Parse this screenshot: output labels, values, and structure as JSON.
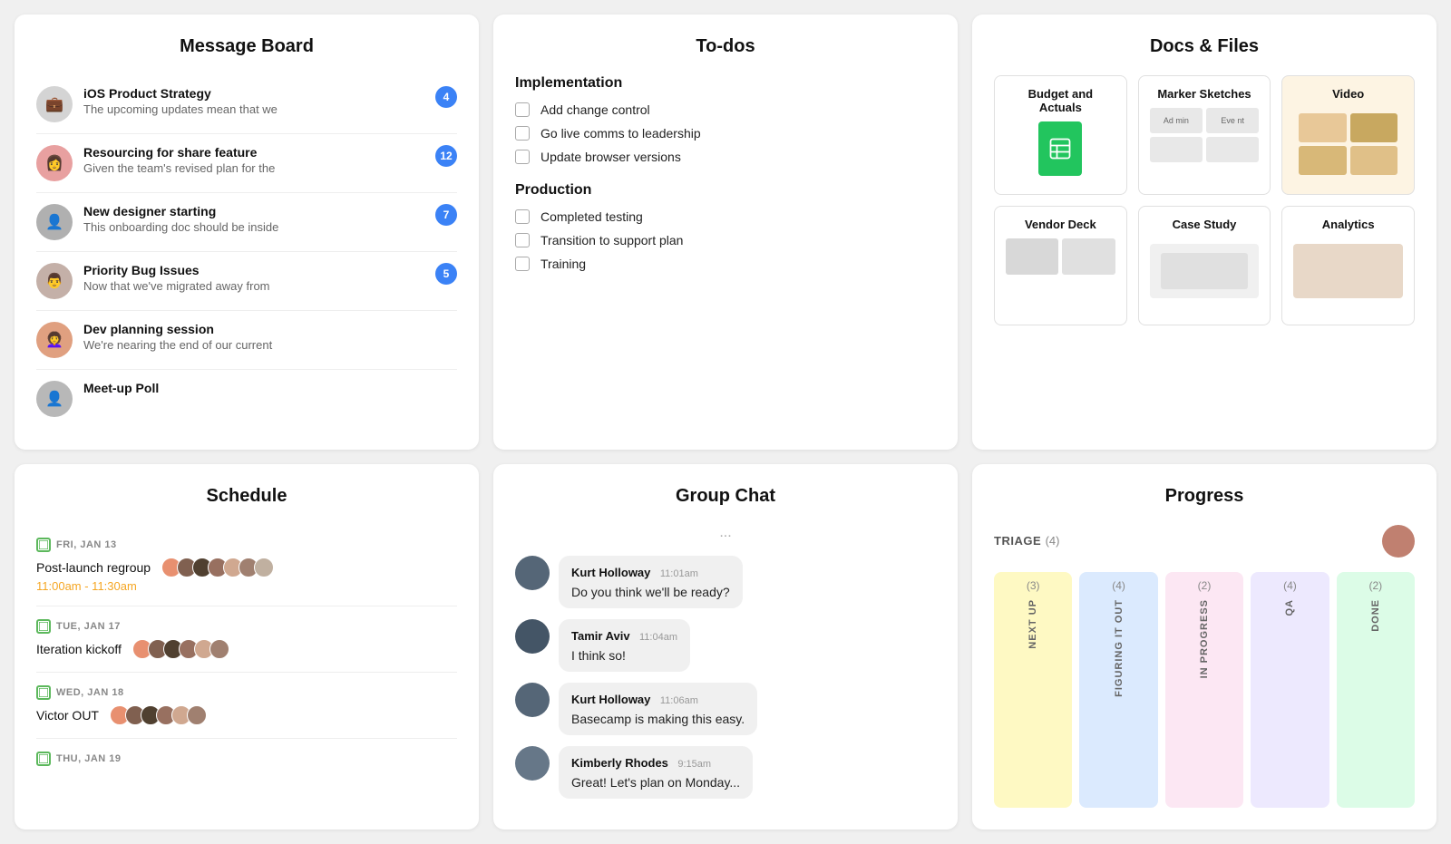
{
  "messageBoard": {
    "title": "Message Board",
    "messages": [
      {
        "id": 1,
        "title": "iOS Product Strategy",
        "preview": "The upcoming updates mean that we",
        "badge": 4,
        "avatarClass": "av-ios",
        "avatarEmoji": "💼"
      },
      {
        "id": 2,
        "title": "Resourcing for share feature",
        "preview": "Given the team's revised plan for the",
        "badge": 12,
        "avatarClass": "av-res",
        "avatarEmoji": "👩"
      },
      {
        "id": 3,
        "title": "New designer starting",
        "preview": "This onboarding doc should be inside",
        "badge": 7,
        "avatarClass": "av-new",
        "avatarEmoji": "👤"
      },
      {
        "id": 4,
        "title": "Priority Bug Issues",
        "preview": "Now that we've migrated away from",
        "badge": 5,
        "avatarClass": "av-pri",
        "avatarEmoji": "👨"
      },
      {
        "id": 5,
        "title": "Dev planning session",
        "preview": "We're nearing the end of our current",
        "badge": null,
        "avatarClass": "av-dev",
        "avatarEmoji": "👩‍🦱"
      },
      {
        "id": 6,
        "title": "Meet-up Poll",
        "preview": "",
        "badge": null,
        "avatarClass": "av-meet",
        "avatarEmoji": "👤"
      }
    ]
  },
  "todos": {
    "title": "To-dos",
    "sections": [
      {
        "title": "Implementation",
        "items": [
          "Add change control",
          "Go live comms to leadership",
          "Update browser versions"
        ]
      },
      {
        "title": "Production",
        "items": [
          "Completed testing",
          "Transition to support plan",
          "Training"
        ]
      }
    ]
  },
  "docs": {
    "title": "Docs & Files",
    "items": [
      {
        "id": "budget",
        "label": "Budget and Actuals",
        "type": "spreadsheet"
      },
      {
        "id": "marker",
        "label": "Marker Sketches",
        "type": "sketches"
      },
      {
        "id": "video",
        "label": "Video",
        "type": "video"
      },
      {
        "id": "vendor",
        "label": "Vendor Deck",
        "type": "deck"
      },
      {
        "id": "casestudy",
        "label": "Case Study",
        "type": "doc"
      },
      {
        "id": "analytics",
        "label": "Analytics",
        "type": "doc2"
      }
    ]
  },
  "schedule": {
    "title": "Schedule",
    "events": [
      {
        "date": "FRI, JAN 13",
        "title": "Post-launch regroup",
        "time": "11:00am - 11:30am",
        "hasAvatars": true,
        "avatarCount": 7
      },
      {
        "date": "TUE, JAN 17",
        "title": "Iteration kickoff",
        "time": null,
        "hasAvatars": true,
        "avatarCount": 6
      },
      {
        "date": "WED, JAN 18",
        "title": "Victor OUT",
        "time": null,
        "hasAvatars": true,
        "avatarCount": 6
      },
      {
        "date": "THU, JAN 19",
        "title": "",
        "time": null,
        "hasAvatars": false,
        "avatarCount": 0
      }
    ]
  },
  "groupChat": {
    "title": "Group Chat",
    "typing": "...",
    "messages": [
      {
        "name": "Kurt Holloway",
        "time": "11:01am",
        "text": "Do you think we'll be ready?",
        "avatarClass": "chat-av-kurt"
      },
      {
        "name": "Tamir Aviv",
        "time": "11:04am",
        "text": "I think so!",
        "avatarClass": "chat-av-tamir"
      },
      {
        "name": "Kurt Holloway",
        "time": "11:06am",
        "text": "Basecamp is making this easy.",
        "avatarClass": "chat-av-kurt"
      },
      {
        "name": "Kimberly Rhodes",
        "time": "9:15am",
        "text": "Great! Let's plan on Monday...",
        "avatarClass": "chat-av-kimberly"
      }
    ]
  },
  "progress": {
    "title": "Progress",
    "triageLabel": "TRIAGE",
    "triageCount": "(4)",
    "columns": [
      {
        "label": "NEXT UP",
        "count": "(3)",
        "colorClass": "col-yellow"
      },
      {
        "label": "FIGURING IT OUT",
        "count": "(4)",
        "colorClass": "col-blue"
      },
      {
        "label": "IN PROGRESS",
        "count": "(2)",
        "colorClass": "col-pink"
      },
      {
        "label": "QA",
        "count": "(4)",
        "colorClass": "col-purple"
      },
      {
        "label": "DONE",
        "count": "(2)",
        "colorClass": "col-green"
      }
    ]
  }
}
